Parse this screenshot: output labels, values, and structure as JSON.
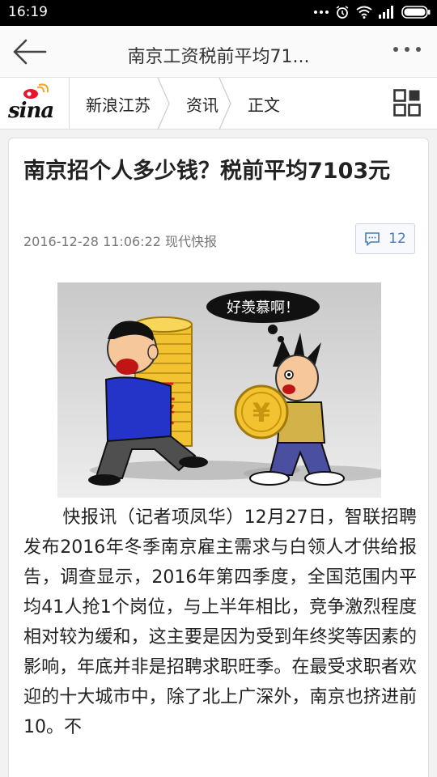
{
  "status_bar": {
    "time": "16:19"
  },
  "title_bar": {
    "title": "南京工资税前平均71..."
  },
  "nav": {
    "logo_text": "sina",
    "breadcrumbs": [
      "新浪江苏",
      "资讯",
      "正文"
    ]
  },
  "article": {
    "headline": "南京招个人多少钱？税前平均7103元",
    "datetime": "2016-12-28 11:06:22",
    "source": "现代快报",
    "comment_count": "12",
    "illustration": {
      "speech_bubble": "好羡慕啊！",
      "salary_label": "工资",
      "coin_symbol": "¥"
    },
    "body": "快报讯（记者项凤华）12月27日，智联招聘发布2016年冬季南京雇主需求与白领人才供给报告，调查显示，2016年第四季度，全国范围内平均41人抢1个岗位，与上半年相比，竞争激烈程度相对较为缓和，这主要是因为受到年终奖等因素的影响，年底并非是招聘求职旺季。在最受求职者欢迎的十大城市中，除了北上广深外，南京也挤进前10。不"
  },
  "colors": {
    "accent": "#4a7bb7",
    "sina_red": "#e6162d"
  }
}
